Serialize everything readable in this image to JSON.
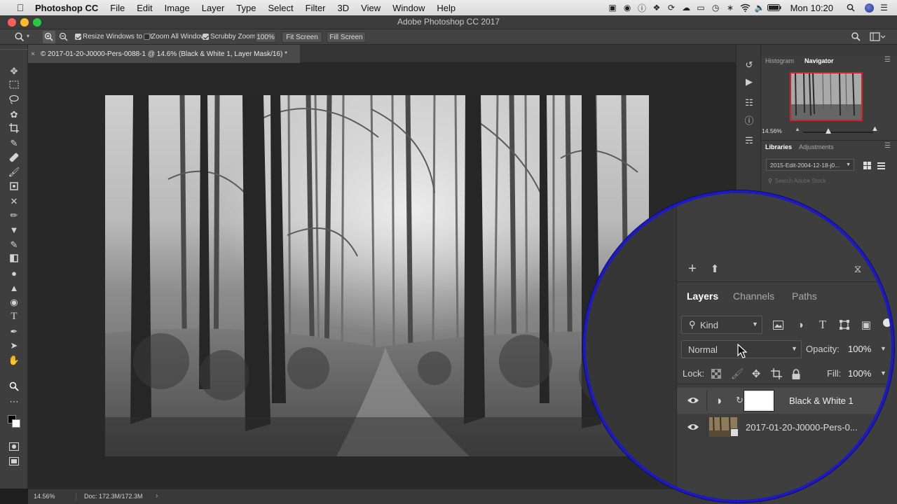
{
  "menubar": {
    "app_name": "Photoshop CC",
    "items": [
      "File",
      "Edit",
      "Image",
      "Layer",
      "Type",
      "Select",
      "Filter",
      "3D",
      "View",
      "Window",
      "Help"
    ],
    "clock": "Mon 10:20"
  },
  "window": {
    "title": "Adobe Photoshop CC 2017"
  },
  "options_bar": {
    "resize_windows_label": "Resize Windows to Fit",
    "zoom_all_label": "Zoom All Windows",
    "scrubby_zoom_label": "Scrubby Zoom",
    "zoom_value": "100%",
    "fit_screen_label": "Fit Screen",
    "fill_screen_label": "Fill Screen",
    "resize_windows_checked": true,
    "zoom_all_checked": false,
    "scrubby_checked": true
  },
  "document": {
    "tab_title": "© 2017-01-20-J0000-Pers-0088-1 @ 14.6% (Black & White 1, Layer Mask/16) *",
    "close_glyph": "×"
  },
  "status_bar": {
    "zoom": "14.56%",
    "doc_info": "Doc: 172.3M/172.3M"
  },
  "navigator_panel": {
    "tabs": [
      "Histogram",
      "Navigator"
    ],
    "active_tab": "Navigator",
    "zoom": "14.56%"
  },
  "libraries_panel": {
    "tabs": [
      "Libraries",
      "Adjustments"
    ],
    "active_tab": "Libraries",
    "library_name": "2015-Edit-2004-12-18-j0...",
    "search_placeholder": "Search Adobe Stock"
  },
  "layers_panel": {
    "tabs": [
      "Layers",
      "Channels",
      "Paths"
    ],
    "active_tab": "Layers",
    "filter_kind": "Kind",
    "blend_mode": "Normal",
    "opacity_label": "Opacity:",
    "opacity_value": "100%",
    "lock_label": "Lock:",
    "fill_label": "Fill:",
    "fill_value": "100%",
    "layers": [
      {
        "name": "Black & White 1",
        "type": "adjustment"
      },
      {
        "name": "2017-01-20-J0000-Pers-0...",
        "type": "pixel"
      }
    ]
  },
  "colors": {
    "magnifier_border": "#1d1ac4",
    "navigator_view_box": "#d81f2c",
    "panel_bg": "#3e3e3e",
    "canvas_bg": "#282828"
  }
}
